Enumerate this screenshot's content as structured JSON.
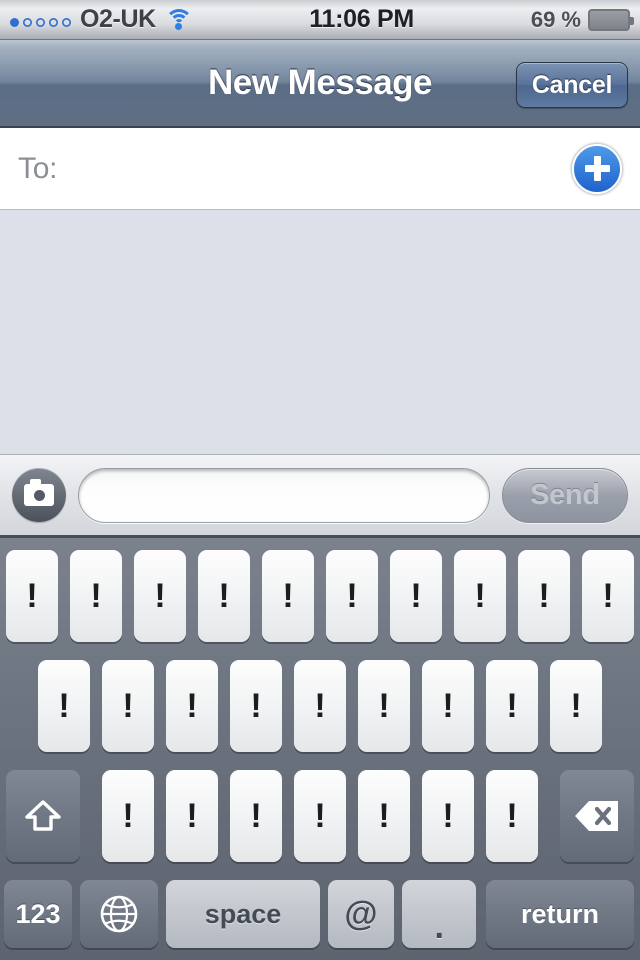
{
  "statusbar": {
    "carrier": "O2-UK",
    "signal_bars_filled": 1,
    "signal_bars_total": 5,
    "wifi_icon": "wifi-icon",
    "time": "11:06 PM",
    "battery_percent": "69 %",
    "battery_level": 69
  },
  "navbar": {
    "title": "New Message",
    "cancel_label": "Cancel"
  },
  "recipient": {
    "label": "To:",
    "value": "",
    "placeholder": "",
    "add_contact_icon": "plus-icon"
  },
  "compose": {
    "camera_icon": "camera-icon",
    "message_value": "",
    "message_placeholder": "",
    "send_label": "Send"
  },
  "keyboard": {
    "row1": [
      "!",
      "!",
      "!",
      "!",
      "!",
      "!",
      "!",
      "!",
      "!",
      "!"
    ],
    "row2": [
      "!",
      "!",
      "!",
      "!",
      "!",
      "!",
      "!",
      "!",
      "!"
    ],
    "row3": [
      "!",
      "!",
      "!",
      "!",
      "!",
      "!",
      "!"
    ],
    "shift_icon": "shift-icon",
    "backspace_icon": "backspace-icon",
    "numeric_label": "123",
    "globe_icon": "globe-icon",
    "space_label": "space",
    "at_label": "@",
    "period_label": ".",
    "return_label": "return"
  },
  "colors": {
    "accent_blue": "#2f6fd0",
    "battery_green": "#49c22a",
    "navbar_blue": "#6b7f99",
    "body_bg": "#dce1e9",
    "keyboard_bg": "#6e7682"
  }
}
